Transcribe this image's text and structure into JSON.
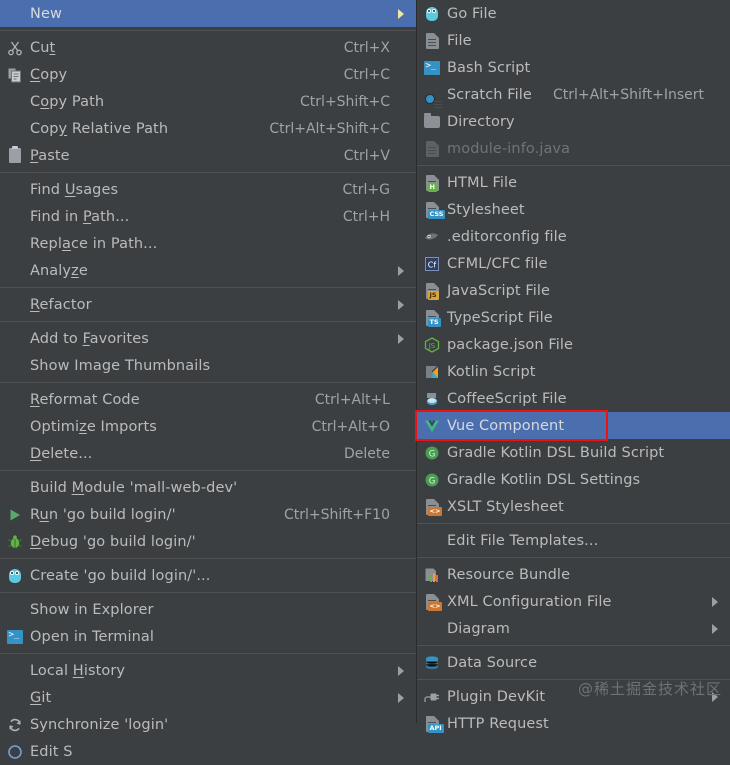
{
  "theme": {
    "menu_bg": "#3c3f41",
    "text": "#bbbbbb",
    "selection_bg": "#4b6eaf",
    "separator": "#515151",
    "annotation": "#ee1111",
    "disabled_text": "#6f7376"
  },
  "watermark": "@稀土掘金技术社区",
  "context_menu": {
    "name": "editor-context-menu",
    "groups": [
      {
        "items": [
          {
            "label": "New",
            "icon": "none",
            "accel": "",
            "submenu": true,
            "selected": true,
            "mnemonic": ""
          }
        ]
      },
      {
        "items": [
          {
            "label": "Cut",
            "icon": "scissors-icon",
            "accel": "Ctrl+X",
            "submenu": false,
            "mnemonic": "t"
          },
          {
            "label": "Copy",
            "icon": "copy-icon",
            "accel": "Ctrl+C",
            "submenu": false,
            "mnemonic": "C"
          },
          {
            "label": "Copy Path",
            "icon": "none",
            "accel": "Ctrl+Shift+C",
            "submenu": false,
            "mnemonic": "o"
          },
          {
            "label": "Copy Relative Path",
            "icon": "none",
            "accel": "Ctrl+Alt+Shift+C",
            "submenu": false,
            "mnemonic": "y"
          },
          {
            "label": "Paste",
            "icon": "clipboard-icon",
            "accel": "Ctrl+V",
            "submenu": false,
            "mnemonic": "P"
          }
        ]
      },
      {
        "items": [
          {
            "label": "Find Usages",
            "icon": "none",
            "accel": "Ctrl+G",
            "submenu": false,
            "mnemonic": "U"
          },
          {
            "label": "Find in Path...",
            "icon": "none",
            "accel": "Ctrl+H",
            "submenu": false,
            "mnemonic": "P"
          },
          {
            "label": "Replace in Path...",
            "icon": "none",
            "accel": "",
            "submenu": false,
            "mnemonic": "a"
          },
          {
            "label": "Analyze",
            "icon": "none",
            "accel": "",
            "submenu": true,
            "mnemonic": "z"
          }
        ]
      },
      {
        "items": [
          {
            "label": "Refactor",
            "icon": "none",
            "accel": "",
            "submenu": true,
            "mnemonic": "R"
          }
        ]
      },
      {
        "items": [
          {
            "label": "Add to Favorites",
            "icon": "none",
            "accel": "",
            "submenu": true,
            "mnemonic": "F"
          },
          {
            "label": "Show Image Thumbnails",
            "icon": "none",
            "accel": "",
            "submenu": false,
            "mnemonic": ""
          }
        ]
      },
      {
        "items": [
          {
            "label": "Reformat Code",
            "icon": "none",
            "accel": "Ctrl+Alt+L",
            "submenu": false,
            "mnemonic": "R"
          },
          {
            "label": "Optimize Imports",
            "icon": "none",
            "accel": "Ctrl+Alt+O",
            "submenu": false,
            "mnemonic": "z"
          },
          {
            "label": "Delete...",
            "icon": "none",
            "accel": "Delete",
            "submenu": false,
            "mnemonic": "D"
          }
        ]
      },
      {
        "items": [
          {
            "label": "Build Module 'mall-web-dev'",
            "icon": "none",
            "accel": "",
            "submenu": false,
            "mnemonic": "M"
          },
          {
            "label": "Run 'go build login/'",
            "icon": "run-icon",
            "accel": "Ctrl+Shift+F10",
            "submenu": false,
            "mnemonic": "u"
          },
          {
            "label": "Debug 'go build login/'",
            "icon": "debug-icon",
            "accel": "",
            "submenu": false,
            "mnemonic": "D"
          }
        ]
      },
      {
        "items": [
          {
            "label": "Create 'go build login/'...",
            "icon": "go-icon",
            "accel": "",
            "submenu": false,
            "mnemonic": ""
          }
        ]
      },
      {
        "items": [
          {
            "label": "Show in Explorer",
            "icon": "none",
            "accel": "",
            "submenu": false,
            "mnemonic": ""
          },
          {
            "label": "Open in Terminal",
            "icon": "terminal-icon",
            "accel": "",
            "submenu": false,
            "mnemonic": ""
          }
        ]
      },
      {
        "items": [
          {
            "label": "Local History",
            "icon": "none",
            "accel": "",
            "submenu": true,
            "mnemonic": "H"
          },
          {
            "label": "Git",
            "icon": "none",
            "accel": "",
            "submenu": true,
            "mnemonic": "G"
          },
          {
            "label": "Synchronize 'login'",
            "icon": "sync-icon",
            "accel": "",
            "submenu": false,
            "mnemonic": ""
          },
          {
            "label": "Edit S",
            "icon": "edit-scopes-icon",
            "accel": "",
            "submenu": false,
            "mnemonic": "",
            "clipped": true
          }
        ]
      }
    ]
  },
  "new_submenu": {
    "name": "new-submenu",
    "groups": [
      {
        "items": [
          {
            "label": "Go File",
            "icon": "go-icon",
            "accel": "",
            "submenu": false
          },
          {
            "label": "File",
            "icon": "file-icon",
            "accel": "",
            "submenu": false
          },
          {
            "label": "Bash Script",
            "icon": "terminal-icon",
            "accel": "",
            "submenu": false
          },
          {
            "label": "Scratch File",
            "icon": "scratch-file-icon",
            "accel": "Ctrl+Alt+Shift+Insert",
            "submenu": false
          },
          {
            "label": "Directory",
            "icon": "folder-icon",
            "accel": "",
            "submenu": false
          },
          {
            "label": "module-info.java",
            "icon": "java-file-icon",
            "accel": "",
            "submenu": false,
            "disabled": true
          }
        ]
      },
      {
        "items": [
          {
            "label": "HTML File",
            "icon": "html-file-icon",
            "accel": "",
            "submenu": false
          },
          {
            "label": "Stylesheet",
            "icon": "css-file-icon",
            "accel": "",
            "submenu": false
          },
          {
            "label": ".editorconfig file",
            "icon": "editorconfig-icon",
            "accel": "",
            "submenu": false
          },
          {
            "label": "CFML/CFC file",
            "icon": "cfml-icon",
            "accel": "",
            "submenu": false
          },
          {
            "label": "JavaScript File",
            "icon": "js-file-icon",
            "accel": "",
            "submenu": false
          },
          {
            "label": "TypeScript File",
            "icon": "ts-file-icon",
            "accel": "",
            "submenu": false
          },
          {
            "label": "package.json File",
            "icon": "nodejs-icon",
            "accel": "",
            "submenu": false
          },
          {
            "label": "Kotlin Script",
            "icon": "kotlin-icon",
            "accel": "",
            "submenu": false
          },
          {
            "label": "CoffeeScript File",
            "icon": "coffeescript-icon",
            "accel": "",
            "submenu": false
          },
          {
            "label": "Vue Component",
            "icon": "vue-icon",
            "accel": "",
            "submenu": false,
            "selected": true,
            "annotated": true
          },
          {
            "label": "Gradle Kotlin DSL Build Script",
            "icon": "gradle-icon",
            "accel": "",
            "submenu": false
          },
          {
            "label": "Gradle Kotlin DSL Settings",
            "icon": "gradle-icon",
            "accel": "",
            "submenu": false
          },
          {
            "label": "XSLT Stylesheet",
            "icon": "xslt-file-icon",
            "accel": "",
            "submenu": false
          }
        ]
      },
      {
        "items": [
          {
            "label": "Edit File Templates...",
            "icon": "none",
            "accel": "",
            "submenu": false
          }
        ]
      },
      {
        "items": [
          {
            "label": "Resource Bundle",
            "icon": "resource-bundle-icon",
            "accel": "",
            "submenu": false
          },
          {
            "label": "XML Configuration File",
            "icon": "xml-file-icon",
            "accel": "",
            "submenu": true
          },
          {
            "label": "Diagram",
            "icon": "none",
            "accel": "",
            "submenu": true
          }
        ]
      },
      {
        "items": [
          {
            "label": "Data Source",
            "icon": "database-icon",
            "accel": "",
            "submenu": false
          }
        ]
      },
      {
        "items": [
          {
            "label": "Plugin DevKit",
            "icon": "plugin-icon",
            "accel": "",
            "submenu": true
          },
          {
            "label": "HTTP Request",
            "icon": "http-request-icon",
            "accel": "",
            "submenu": false
          }
        ]
      }
    ]
  }
}
